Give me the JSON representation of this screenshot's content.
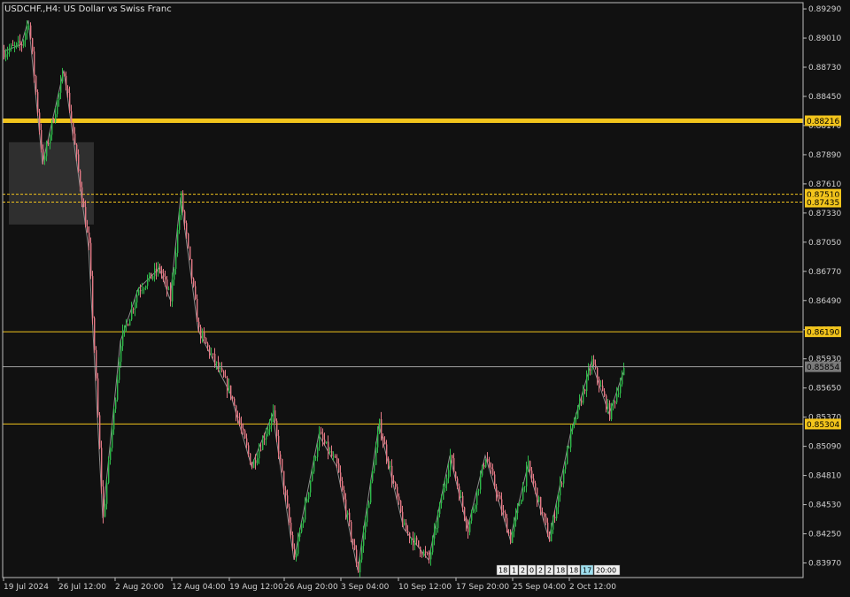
{
  "header": {
    "symbol_line": "USDCHF.,H4:  US Dollar vs Swiss Franc"
  },
  "colors": {
    "background": "#111111",
    "axis": "#bdbdbd",
    "bull": "#2fb84a",
    "bear": "#e57b87",
    "level": "#f2c41c",
    "current_line": "#a0a0a0",
    "current_tag": "#7a7a7a",
    "zone": "#3a3a3a",
    "zigzag": "#8c8c8c"
  },
  "chart_data": {
    "type": "candlestick",
    "y_range": [
      0.8383,
      0.8935
    ],
    "y_ticks": [
      "0.89290",
      "0.89010",
      "0.88730",
      "0.88450",
      "0.88170",
      "0.87890",
      "0.87610",
      "0.87330",
      "0.87050",
      "0.86770",
      "0.86490",
      "0.86210",
      "0.85930",
      "0.85650",
      "0.85370",
      "0.85090",
      "0.84810",
      "0.84530",
      "0.84250",
      "0.83970"
    ],
    "x_ticks": [
      "19 Jul 2024",
      "26 Jul 12:00",
      "2 Aug 20:00",
      "12 Aug 04:00",
      "19 Aug 12:00",
      "26 Aug 20:00",
      "3 Sep 04:00",
      "10 Sep 12:00",
      "17 Sep 20:00",
      "25 Sep 04:00",
      "2 Oct 12:00"
    ],
    "levels": [
      {
        "price": 0.88216,
        "label": "0.88216",
        "style": "thick"
      },
      {
        "price": 0.8751,
        "label": "0.87510",
        "style": "dashed"
      },
      {
        "price": 0.87435,
        "label": "0.87435",
        "style": "dashed"
      },
      {
        "price": 0.8619,
        "label": "0.86190",
        "style": "solid"
      },
      {
        "price": 0.85304,
        "label": "0.85304",
        "style": "solid"
      }
    ],
    "current_price": {
      "price": 0.85854,
      "label": "0.85854"
    },
    "zone": {
      "from_bar": 3,
      "to_bar": 51,
      "price_top": 0.8801,
      "price_bottom": 0.8722
    },
    "marker_labels": [
      "18",
      "1",
      "2",
      "0",
      "2",
      "2",
      "18",
      "18",
      "17",
      "20:00"
    ],
    "zigzag": [
      [
        0,
        0.8888
      ],
      [
        10,
        0.8895
      ],
      [
        14,
        0.8918
      ],
      [
        22,
        0.878
      ],
      [
        34,
        0.887
      ],
      [
        48,
        0.87
      ],
      [
        56,
        0.844
      ],
      [
        66,
        0.861
      ],
      [
        76,
        0.866
      ],
      [
        88,
        0.868
      ],
      [
        94,
        0.865
      ],
      [
        100,
        0.8748
      ],
      [
        110,
        0.862
      ],
      [
        128,
        0.856
      ],
      [
        140,
        0.849
      ],
      [
        152,
        0.854
      ],
      [
        164,
        0.84
      ],
      [
        178,
        0.852
      ],
      [
        188,
        0.849
      ],
      [
        200,
        0.839
      ],
      [
        212,
        0.853
      ],
      [
        226,
        0.843
      ],
      [
        240,
        0.84
      ],
      [
        252,
        0.85
      ],
      [
        262,
        0.843
      ],
      [
        272,
        0.85
      ],
      [
        286,
        0.842
      ],
      [
        296,
        0.849
      ],
      [
        308,
        0.842
      ],
      [
        320,
        0.852
      ],
      [
        332,
        0.859
      ],
      [
        342,
        0.854
      ],
      [
        350,
        0.858
      ]
    ]
  }
}
